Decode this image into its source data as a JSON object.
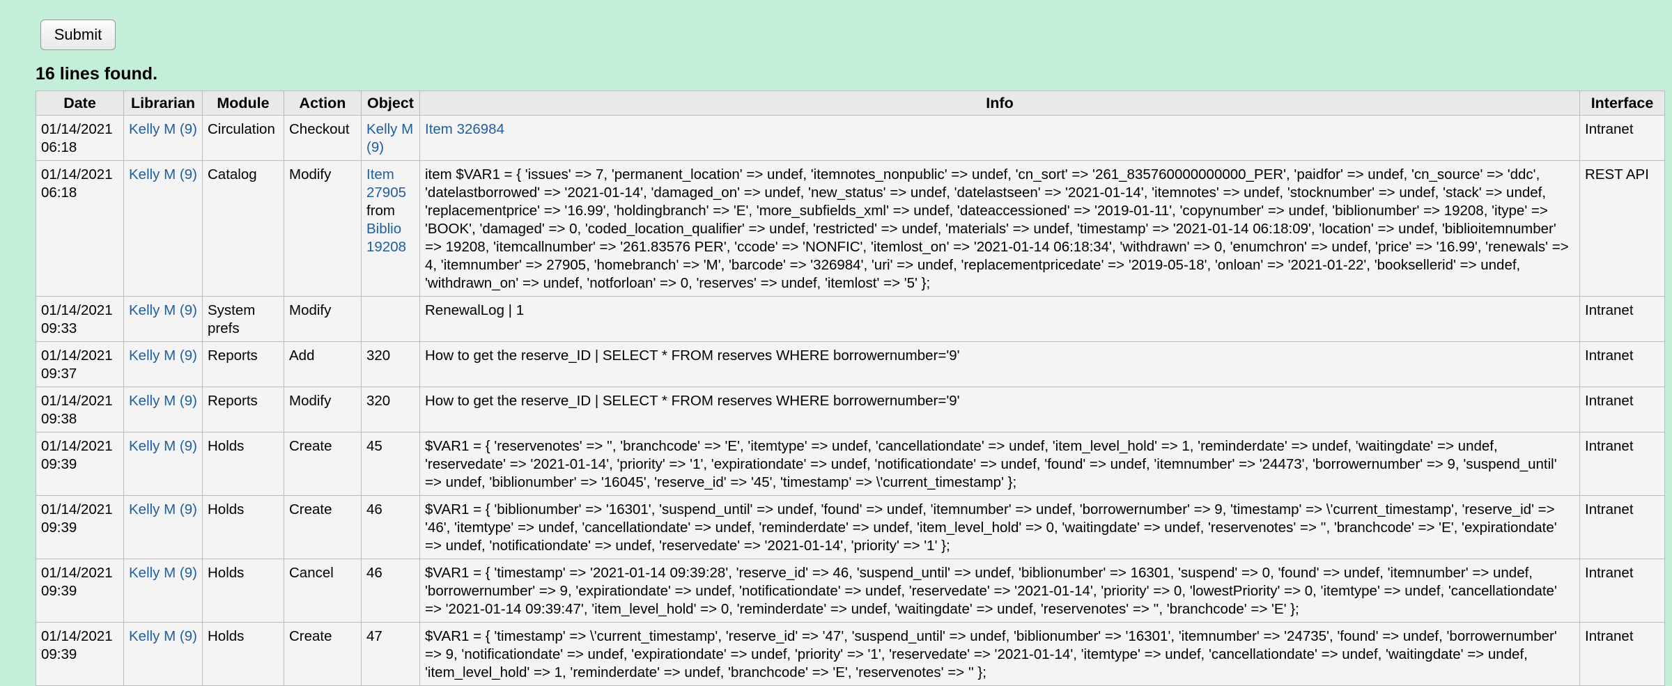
{
  "form": {
    "submit_label": "Submit"
  },
  "summary": "16 lines found.",
  "table": {
    "headers": [
      "Date",
      "Librarian",
      "Module",
      "Action",
      "Object",
      "Info",
      "Interface"
    ],
    "rows": [
      {
        "date": "01/14/2021 06:18",
        "librarian": "Kelly M (9)",
        "module": "Circulation",
        "action": "Checkout",
        "object": "Kelly M (9)",
        "object_link": true,
        "info": "Item 326984",
        "info_link": true,
        "interface": "Intranet"
      },
      {
        "date": "01/14/2021 06:18",
        "librarian": "Kelly M (9)",
        "module": "Catalog",
        "action": "Modify",
        "object_item": "Item 27905",
        "object_from": "from",
        "object_biblio": "Biblio 19208",
        "info": "item $VAR1 = { 'issues' => 7, 'permanent_location' => undef, 'itemnotes_nonpublic' => undef, 'cn_sort' => '261_835760000000000_PER', 'paidfor' => undef, 'cn_source' => 'ddc', 'datelastborrowed' => '2021-01-14', 'damaged_on' => undef, 'new_status' => undef, 'datelastseen' => '2021-01-14', 'itemnotes' => undef, 'stocknumber' => undef, 'stack' => undef, 'replacementprice' => '16.99', 'holdingbranch' => 'E', 'more_subfields_xml' => undef, 'dateaccessioned' => '2019-01-11', 'copynumber' => undef, 'biblionumber' => 19208, 'itype' => 'BOOK', 'damaged' => 0, 'coded_location_qualifier' => undef, 'restricted' => undef, 'materials' => undef, 'timestamp' => '2021-01-14 06:18:09', 'location' => undef, 'biblioitemnumber' => 19208, 'itemcallnumber' => '261.83576 PER', 'ccode' => 'NONFIC', 'itemlost_on' => '2021-01-14 06:18:34', 'withdrawn' => 0, 'enumchron' => undef, 'price' => '16.99', 'renewals' => 4, 'itemnumber' => 27905, 'homebranch' => 'M', 'barcode' => '326984', 'uri' => undef, 'replacementpricedate' => '2019-05-18', 'onloan' => '2021-01-22', 'booksellerid' => undef, 'withdrawn_on' => undef, 'notforloan' => 0, 'reserves' => undef, 'itemlost' => '5' };",
        "interface": "REST API"
      },
      {
        "date": "01/14/2021 09:33",
        "librarian": "Kelly M (9)",
        "module": "System prefs",
        "action": "Modify",
        "object": "",
        "info": "RenewalLog | 1",
        "interface": "Intranet"
      },
      {
        "date": "01/14/2021 09:37",
        "librarian": "Kelly M (9)",
        "module": "Reports",
        "action": "Add",
        "object": "320",
        "info": "How to get the reserve_ID | SELECT * FROM reserves WHERE borrowernumber='9'",
        "interface": "Intranet"
      },
      {
        "date": "01/14/2021 09:38",
        "librarian": "Kelly M (9)",
        "module": "Reports",
        "action": "Modify",
        "object": "320",
        "info": "How to get the reserve_ID | SELECT * FROM reserves WHERE borrowernumber='9'",
        "interface": "Intranet"
      },
      {
        "date": "01/14/2021 09:39",
        "librarian": "Kelly M (9)",
        "module": "Holds",
        "action": "Create",
        "object": "45",
        "info": "$VAR1 = { 'reservenotes' => '', 'branchcode' => 'E', 'itemtype' => undef, 'cancellationdate' => undef, 'item_level_hold' => 1, 'reminderdate' => undef, 'waitingdate' => undef, 'reservedate' => '2021-01-14', 'priority' => '1', 'expirationdate' => undef, 'notificationdate' => undef, 'found' => undef, 'itemnumber' => '24473', 'borrowernumber' => 9, 'suspend_until' => undef, 'biblionumber' => '16045', 'reserve_id' => '45', 'timestamp' => \\'current_timestamp' };",
        "interface": "Intranet"
      },
      {
        "date": "01/14/2021 09:39",
        "librarian": "Kelly M (9)",
        "module": "Holds",
        "action": "Create",
        "object": "46",
        "info": "$VAR1 = { 'biblionumber' => '16301', 'suspend_until' => undef, 'found' => undef, 'itemnumber' => undef, 'borrowernumber' => 9, 'timestamp' => \\'current_timestamp', 'reserve_id' => '46', 'itemtype' => undef, 'cancellationdate' => undef, 'reminderdate' => undef, 'item_level_hold' => 0, 'waitingdate' => undef, 'reservenotes' => '', 'branchcode' => 'E', 'expirationdate' => undef, 'notificationdate' => undef, 'reservedate' => '2021-01-14', 'priority' => '1' };",
        "interface": "Intranet"
      },
      {
        "date": "01/14/2021 09:39",
        "librarian": "Kelly M (9)",
        "module": "Holds",
        "action": "Cancel",
        "object": "46",
        "info": "$VAR1 = { 'timestamp' => '2021-01-14 09:39:28', 'reserve_id' => 46, 'suspend_until' => undef, 'biblionumber' => 16301, 'suspend' => 0, 'found' => undef, 'itemnumber' => undef, 'borrowernumber' => 9, 'expirationdate' => undef, 'notificationdate' => undef, 'reservedate' => '2021-01-14', 'priority' => 0, 'lowestPriority' => 0, 'itemtype' => undef, 'cancellationdate' => '2021-01-14 09:39:47', 'item_level_hold' => 0, 'reminderdate' => undef, 'waitingdate' => undef, 'reservenotes' => '', 'branchcode' => 'E' };",
        "interface": "Intranet"
      },
      {
        "date": "01/14/2021 09:39",
        "librarian": "Kelly M (9)",
        "module": "Holds",
        "action": "Create",
        "object": "47",
        "info": "$VAR1 = { 'timestamp' => \\'current_timestamp', 'reserve_id' => '47', 'suspend_until' => undef, 'biblionumber' => '16301', 'itemnumber' => '24735', 'found' => undef, 'borrowernumber' => 9, 'notificationdate' => undef, 'expirationdate' => undef, 'priority' => '1', 'reservedate' => '2021-01-14', 'itemtype' => undef, 'cancellationdate' => undef, 'waitingdate' => undef, 'item_level_hold' => 1, 'reminderdate' => undef, 'branchcode' => 'E', 'reservenotes' => '' };",
        "interface": "Intranet"
      }
    ]
  },
  "colors": {
    "page_background": "#c3eed8",
    "cell_background": "#f4f4f4",
    "header_background": "#e9e9e9",
    "link": "#1f5e9e",
    "border": "#bcbcbc"
  }
}
